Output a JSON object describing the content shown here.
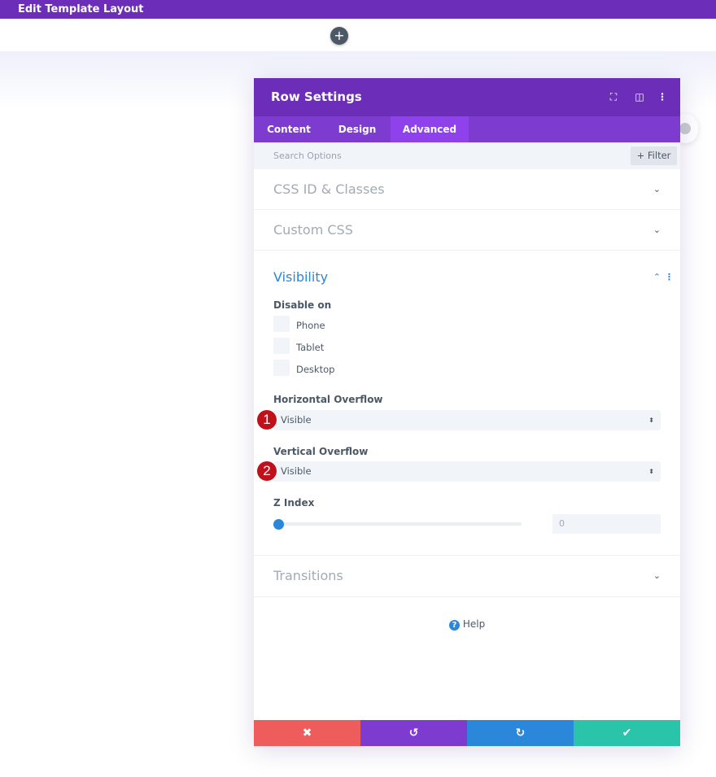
{
  "topbar": {
    "title": "Edit Template Layout"
  },
  "canvas": {
    "add_icon": "+"
  },
  "modal": {
    "title": "Row Settings",
    "header_icons": [
      "fullscreen-icon",
      "split-view-icon",
      "more-options-icon"
    ],
    "tabs": [
      {
        "label": "Content"
      },
      {
        "label": "Design"
      },
      {
        "label": "Advanced",
        "active": true
      }
    ],
    "search": {
      "placeholder": "Search Options",
      "filter_label": "+ Filter"
    },
    "sections": {
      "css": "CSS ID & Classes",
      "custom_css": "Custom CSS",
      "visibility": "Visibility",
      "transitions": "Transitions"
    },
    "visibility": {
      "disable_on_label": "Disable on",
      "devices": [
        {
          "label": "Phone",
          "checked": false
        },
        {
          "label": "Tablet",
          "checked": false
        },
        {
          "label": "Desktop",
          "checked": false
        }
      ],
      "h_overflow": {
        "label": "Horizontal Overflow",
        "value": "Visible",
        "badge": "1"
      },
      "v_overflow": {
        "label": "Vertical Overflow",
        "value": "Visible",
        "badge": "2"
      },
      "z_index": {
        "label": "Z Index",
        "value": "0",
        "slider_fraction": 0
      }
    },
    "help_label": "Help",
    "colors": {
      "header": "#6c2eb9",
      "active_tab": "#8f42ec",
      "cancel": "#ef5c5c",
      "undo": "#7e3bd0",
      "redo": "#2b87da",
      "save": "#29c4a9",
      "visibility_title": "#2b87da"
    }
  }
}
